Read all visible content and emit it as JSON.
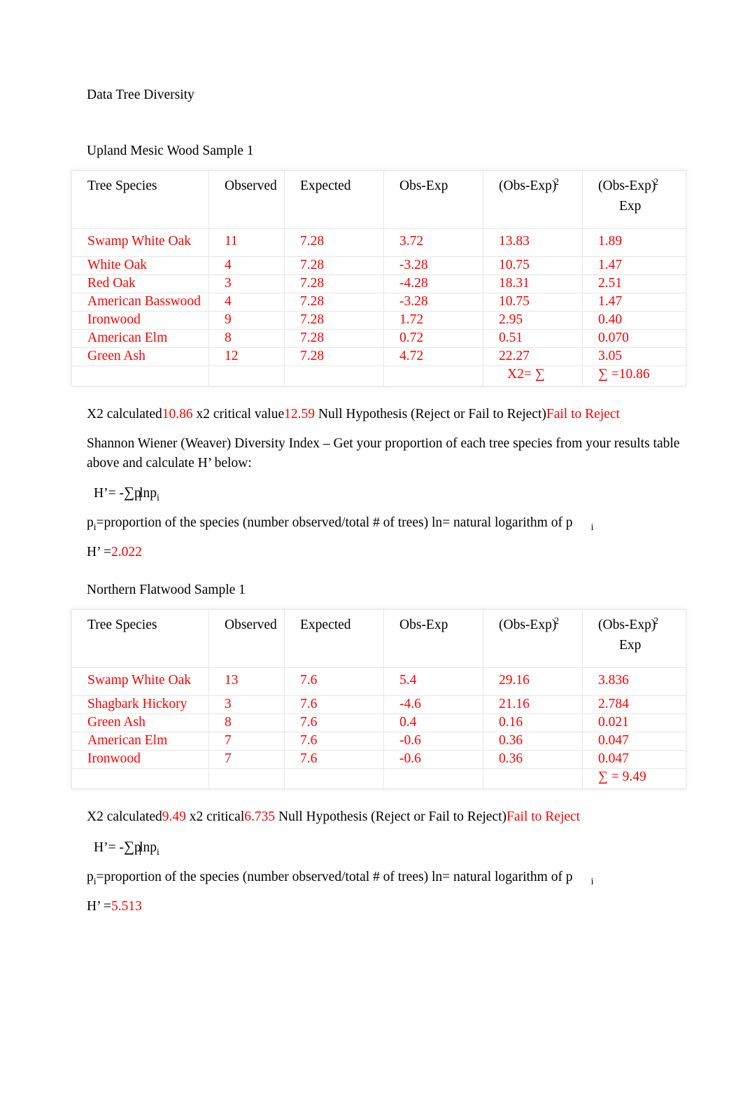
{
  "document": {
    "title": "Data Tree Diversity"
  },
  "section1": {
    "heading": "Upland Mesic Wood Sample 1",
    "table": {
      "headers": {
        "species": "Tree Species",
        "observed": "Observed",
        "expected": "Expected",
        "obs_exp": "Obs-Exp",
        "obs_exp_sq": "(Obs-Exp)",
        "obs_exp_sq_sup": "2",
        "obs_exp_sq_over_exp": "(Obs-Exp)",
        "obs_exp_sq_over_exp_sup": "2",
        "obs_exp_sq_over_exp_den": "Exp"
      },
      "rows": [
        {
          "species": "Swamp White Oak",
          "observed": "11",
          "expected": "7.28",
          "obs_exp": "3.72",
          "obs_exp_sq": "13.83",
          "obs_exp_sq_over_exp": "1.89"
        },
        {
          "species": "White Oak",
          "observed": "4",
          "expected": "7.28",
          "obs_exp": "-3.28",
          "obs_exp_sq": "10.75",
          "obs_exp_sq_over_exp": "1.47"
        },
        {
          "species": "Red Oak",
          "observed": "3",
          "expected": "7.28",
          "obs_exp": "-4.28",
          "obs_exp_sq": "18.31",
          "obs_exp_sq_over_exp": "2.51"
        },
        {
          "species": "American Basswood",
          "observed": "4",
          "expected": "7.28",
          "obs_exp": "-3.28",
          "obs_exp_sq": "10.75",
          "obs_exp_sq_over_exp": "1.47"
        },
        {
          "species": "Ironwood",
          "observed": "9",
          "expected": "7.28",
          "obs_exp": "1.72",
          "obs_exp_sq": "2.95",
          "obs_exp_sq_over_exp": "0.40"
        },
        {
          "species": "American Elm",
          "observed": "8",
          "expected": "7.28",
          "obs_exp": "0.72",
          "obs_exp_sq": "0.51",
          "obs_exp_sq_over_exp": "0.070"
        },
        {
          "species": "Green Ash",
          "observed": "12",
          "expected": "7.28",
          "obs_exp": "4.72",
          "obs_exp_sq": "22.27",
          "obs_exp_sq_over_exp": "3.05"
        }
      ],
      "sum_row": {
        "chi_label": "X2= ∑",
        "sum_value": "∑ =10.86"
      }
    },
    "result_line": {
      "label_a": "X2 calculated",
      "value_a": "10.86",
      "label_b": " x2 critical value",
      "value_b": "12.59",
      "label_c": " Null Hypothesis (Reject or Fail to Reject)",
      "value_c": "Fail to Reject"
    },
    "shannon_intro": "Shannon Wiener (Weaver) Diversity Index – Get your proportion of each tree species from your results table above and calculate H’ below:",
    "formula": {
      "prefix": "H’= -",
      "sigma": "∑",
      "body": "p",
      "sub1": "i",
      "ln": "ln",
      "p2": "p",
      "sub2": "i"
    },
    "legend": {
      "p": "p",
      "p_sub": "i",
      "text": "=proportion of the species (number observed/total # of trees) ln= natural logarithm of p",
      "trailing_sub": "i"
    },
    "h_result": {
      "label": "H’ =",
      "value": "2.022"
    }
  },
  "section2": {
    "heading": "Northern Flatwood Sample 1",
    "table": {
      "headers": {
        "species": "Tree Species",
        "observed": "Observed",
        "expected": "Expected",
        "obs_exp": "Obs-Exp",
        "obs_exp_sq": "(Obs-Exp)",
        "obs_exp_sq_sup": "2",
        "obs_exp_sq_over_exp": "(Obs-Exp)",
        "obs_exp_sq_over_exp_sup": "2",
        "obs_exp_sq_over_exp_den": "Exp"
      },
      "rows": [
        {
          "species": "Swamp White Oak",
          "observed": "13",
          "expected": "7.6",
          "obs_exp": "5.4",
          "obs_exp_sq": "29.16",
          "obs_exp_sq_over_exp": "3.836"
        },
        {
          "species": "Shagbark Hickory",
          "observed": "3",
          "expected": "7.6",
          "obs_exp": "-4.6",
          "obs_exp_sq": "21.16",
          "obs_exp_sq_over_exp": "2.784"
        },
        {
          "species": "Green Ash",
          "observed": "8",
          "expected": "7.6",
          "obs_exp": "0.4",
          "obs_exp_sq": "0.16",
          "obs_exp_sq_over_exp": "0.021"
        },
        {
          "species": "American Elm",
          "observed": "7",
          "expected": "7.6",
          "obs_exp": "-0.6",
          "obs_exp_sq": "0.36",
          "obs_exp_sq_over_exp": "0.047"
        },
        {
          "species": "Ironwood",
          "observed": "7",
          "expected": "7.6",
          "obs_exp": "-0.6",
          "obs_exp_sq": "0.36",
          "obs_exp_sq_over_exp": "0.047"
        }
      ],
      "sum_row": {
        "chi_label": "",
        "sum_value": "∑ = 9.49"
      }
    },
    "result_line": {
      "label_a": "X2 calculated",
      "value_a": "9.49",
      "label_b": " x2 critical",
      "value_b": "6.735",
      "label_c": " Null Hypothesis (Reject or Fail to Reject)",
      "value_c": "Fail to Reject"
    },
    "formula": {
      "prefix": "H’= -",
      "sigma": "∑",
      "body": "p",
      "sub1": "i",
      "ln": "ln",
      "p2": "p",
      "sub2": "i"
    },
    "legend": {
      "p": "p",
      "p_sub": "i",
      "text": "=proportion of the species (number observed/total # of trees) ln= natural logarithm of p",
      "trailing_sub": "i"
    },
    "h_result": {
      "label": "H’ =",
      "value": "5.513"
    }
  },
  "colors": {
    "data_red": "#ff0000",
    "text_black": "#000000",
    "grid": "#e6e6e6"
  }
}
